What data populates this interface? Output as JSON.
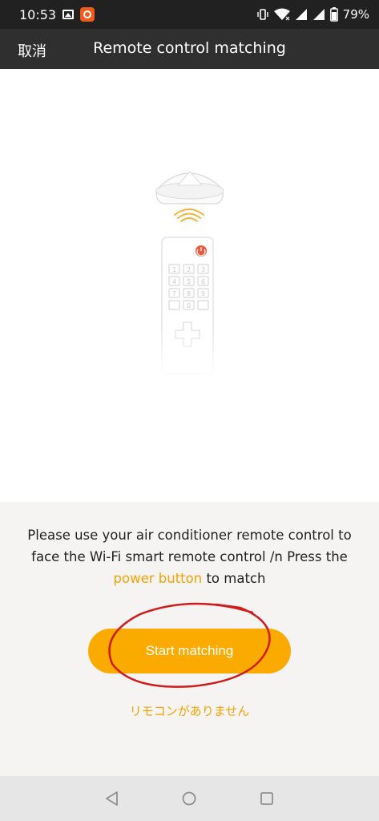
{
  "status_bar": {
    "time": "10:53",
    "battery": "79%"
  },
  "header": {
    "cancel_label": "取消",
    "title": "Remote control matching"
  },
  "illustration": {
    "keypad": [
      "1",
      "2",
      "3",
      "4",
      "5",
      "6",
      "7",
      "8",
      "9",
      "0"
    ]
  },
  "instruction": {
    "text_before": "Please use your air conditioner remote control to face the Wi-Fi smart remote control /n Press the ",
    "highlight": "power button",
    "text_after": " to match"
  },
  "actions": {
    "start_label": "Start matching",
    "no_remote_label": "リモコンがありません"
  },
  "colors": {
    "accent": "#fbab00",
    "link": "#f5a200",
    "header_bg": "#2f2f2f",
    "annotation": "#d11a1a"
  },
  "icons": {
    "status": [
      "image-icon",
      "app-notification-icon",
      "vibrate-icon",
      "wifi-icon",
      "signal-icon",
      "signal-icon-2",
      "battery-icon"
    ],
    "nav": [
      "back-icon",
      "home-icon",
      "recents-icon"
    ]
  }
}
